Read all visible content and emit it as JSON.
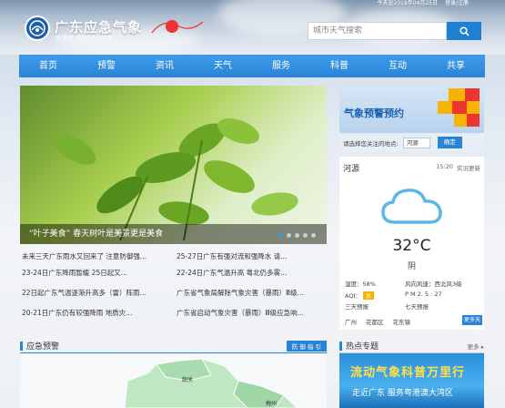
{
  "header": {
    "site_title": "广东应急气象",
    "site_url": "WWW.GD121.CN",
    "slogan": "你冷暖 在我心中",
    "top_date": "今天是2019年04月25日",
    "top_links": "登录/注册",
    "search_placeholder": "城市天气搜索"
  },
  "nav": [
    "首页",
    "预警",
    "资讯",
    "天气",
    "服务",
    "科普",
    "互动",
    "共享"
  ],
  "slider": {
    "caption": "“叶子美食” 春天树叶是美景更是美食",
    "dots": 5,
    "active_dot": 0
  },
  "news": [
    [
      "未来三天广东雨水又回来了 注意防御强...",
      "25-27日广东有强对流和强降水 请..."
    ],
    [
      "23-24日广东降雨暂缓 25日起又...",
      "22-24日广东气温升高 粤北仍多雾..."
    ],
    [
      "22日起广东气温逐渐升高多（雷）阵雨...",
      "广东省气象局解除气象灾害（暴雨）Ⅲ级..."
    ],
    [
      "20-21日广东仍有较强降雨 地质灾...",
      "广东省启动气象灾害（暴雨）Ⅲ级应急响..."
    ]
  ],
  "sections": {
    "warning_title": "应急预警",
    "warning_tab": "防 御 指 引",
    "topic_title": "热点专题",
    "topic_more": "更多 ▸"
  },
  "warn_panel": {
    "title": "气象预警预约",
    "select_label": "请选择您关注的地点:",
    "select_value": "河源",
    "confirm": "确定"
  },
  "weather": {
    "city": "河源",
    "time": "15:20",
    "live": "实况更新",
    "temp": "32°C",
    "cond": "阴",
    "humidity": "湿度：58%",
    "wind": "风向风速：西北风3级",
    "aqi_label": "AQI：",
    "aqi_value": "良",
    "pm": "P M  2. 5 :  27",
    "forecast3": "三天预报",
    "forecast7": "七天预报",
    "cities": [
      "广州",
      "花都区",
      "花东镇"
    ],
    "more": "更多天气"
  },
  "map_label": "韶关",
  "map_label2": "梅州",
  "topic": {
    "line1": "流动气象科普万里行",
    "line2": "走近广东 服务粤港澳大湾区"
  },
  "colors": {
    "accent": "#2a84d6",
    "nav": "#3f9bea"
  }
}
